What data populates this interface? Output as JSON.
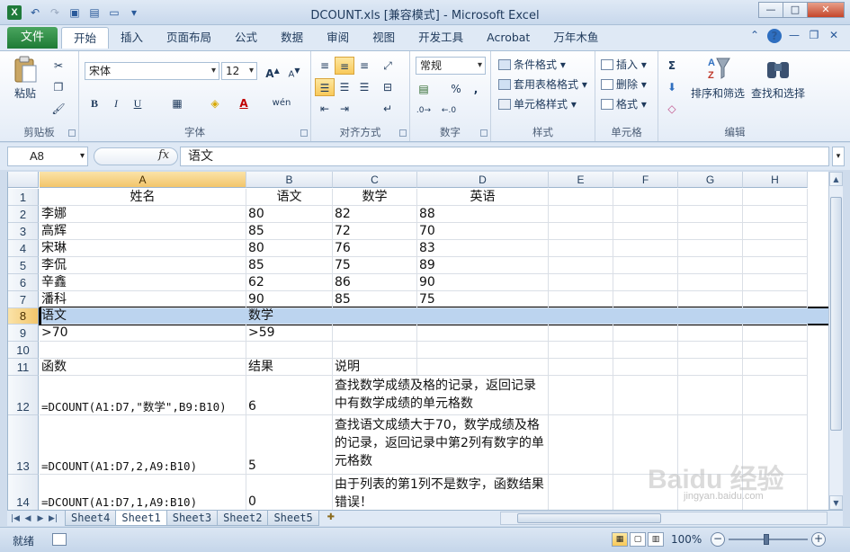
{
  "window": {
    "title": "DCOUNT.xls  [兼容模式] - Microsoft Excel",
    "app_icon": "X"
  },
  "ribbon": {
    "file_tab": "文件",
    "tabs": [
      "开始",
      "插入",
      "页面布局",
      "公式",
      "数据",
      "审阅",
      "视图",
      "开发工具",
      "Acrobat",
      "万年木鱼"
    ],
    "active_tab": "开始",
    "clipboard": {
      "paste": "粘贴",
      "label": "剪贴板"
    },
    "font": {
      "name": "宋体",
      "size": "12",
      "bold": "B",
      "italic": "I",
      "underline": "U",
      "font_grow": "A",
      "font_shrink": "A",
      "phonetic": "wén",
      "label": "字体"
    },
    "alignment": {
      "label": "对齐方式"
    },
    "number": {
      "format": "常规",
      "percent": "%",
      "comma": ",",
      "label": "数字"
    },
    "styles": {
      "conditional": "条件格式",
      "table": "套用表格格式",
      "cell": "单元格样式",
      "label": "样式"
    },
    "cells": {
      "insert": "插入",
      "delete": "删除",
      "format": "格式",
      "label": "单元格"
    },
    "editing": {
      "sort": "排序和筛选",
      "find": "查找和选择",
      "label": "编辑",
      "sum": "Σ"
    }
  },
  "formula_bar": {
    "name_box": "A8",
    "fx": "fx",
    "content": "语文"
  },
  "columns": [
    "A",
    "B",
    "C",
    "D",
    "E",
    "F",
    "G",
    "H"
  ],
  "selected_column": "A",
  "rows": [
    {
      "num": "1",
      "A": "姓名",
      "B": "语文",
      "C": "数学",
      "D": "英语"
    },
    {
      "num": "2",
      "A": "李娜",
      "B": "80",
      "C": "82",
      "D": "88"
    },
    {
      "num": "3",
      "A": "高辉",
      "B": "85",
      "C": "72",
      "D": "70"
    },
    {
      "num": "4",
      "A": "宋琳",
      "B": "80",
      "C": "76",
      "D": "83"
    },
    {
      "num": "5",
      "A": "李侃",
      "B": "85",
      "C": "75",
      "D": "89"
    },
    {
      "num": "6",
      "A": "辛鑫",
      "B": "62",
      "C": "86",
      "D": "90"
    },
    {
      "num": "7",
      "A": "潘科",
      "B": "90",
      "C": "85",
      "D": "75"
    },
    {
      "num": "8",
      "A": "语文",
      "B": "数学",
      "C": "",
      "D": ""
    },
    {
      "num": "9",
      "A": ">70",
      "B": ">59",
      "C": "",
      "D": ""
    },
    {
      "num": "10",
      "A": "",
      "B": "",
      "C": "",
      "D": ""
    },
    {
      "num": "11",
      "A": "函数",
      "B": "结果",
      "C": "说明",
      "D": ""
    },
    {
      "num": "12",
      "A": "=DCOUNT(A1:D7,\"数学\",B9:B10)",
      "B": "6",
      "C": "查找数学成绩及格的记录，返回记录中有数学成绩的单元格数",
      "D": ""
    },
    {
      "num": "13",
      "A": "=DCOUNT(A1:D7,2,A9:B10)",
      "B": "5",
      "C": "查找语文成绩大于70，数学成绩及格的记录，返回记录中第2列有数字的单元格数",
      "D": ""
    },
    {
      "num": "14",
      "A": "=DCOUNT(A1:D7,1,A9:B10)",
      "B": "0",
      "C": "由于列表的第1列不是数字，函数结果错误！",
      "D": ""
    }
  ],
  "selected_row": "8",
  "sheets": [
    "Sheet4",
    "Sheet1",
    "Sheet3",
    "Sheet2",
    "Sheet5"
  ],
  "active_sheet": "Sheet1",
  "status": {
    "ready": "就绪",
    "zoom": "100%"
  },
  "watermark": {
    "brand": "Baidu 经验",
    "url": "jingyan.baidu.com"
  },
  "colors": {
    "accent": "#1e7b35",
    "selection": "#bcd4ef",
    "header_selected": "#f2c56b"
  }
}
